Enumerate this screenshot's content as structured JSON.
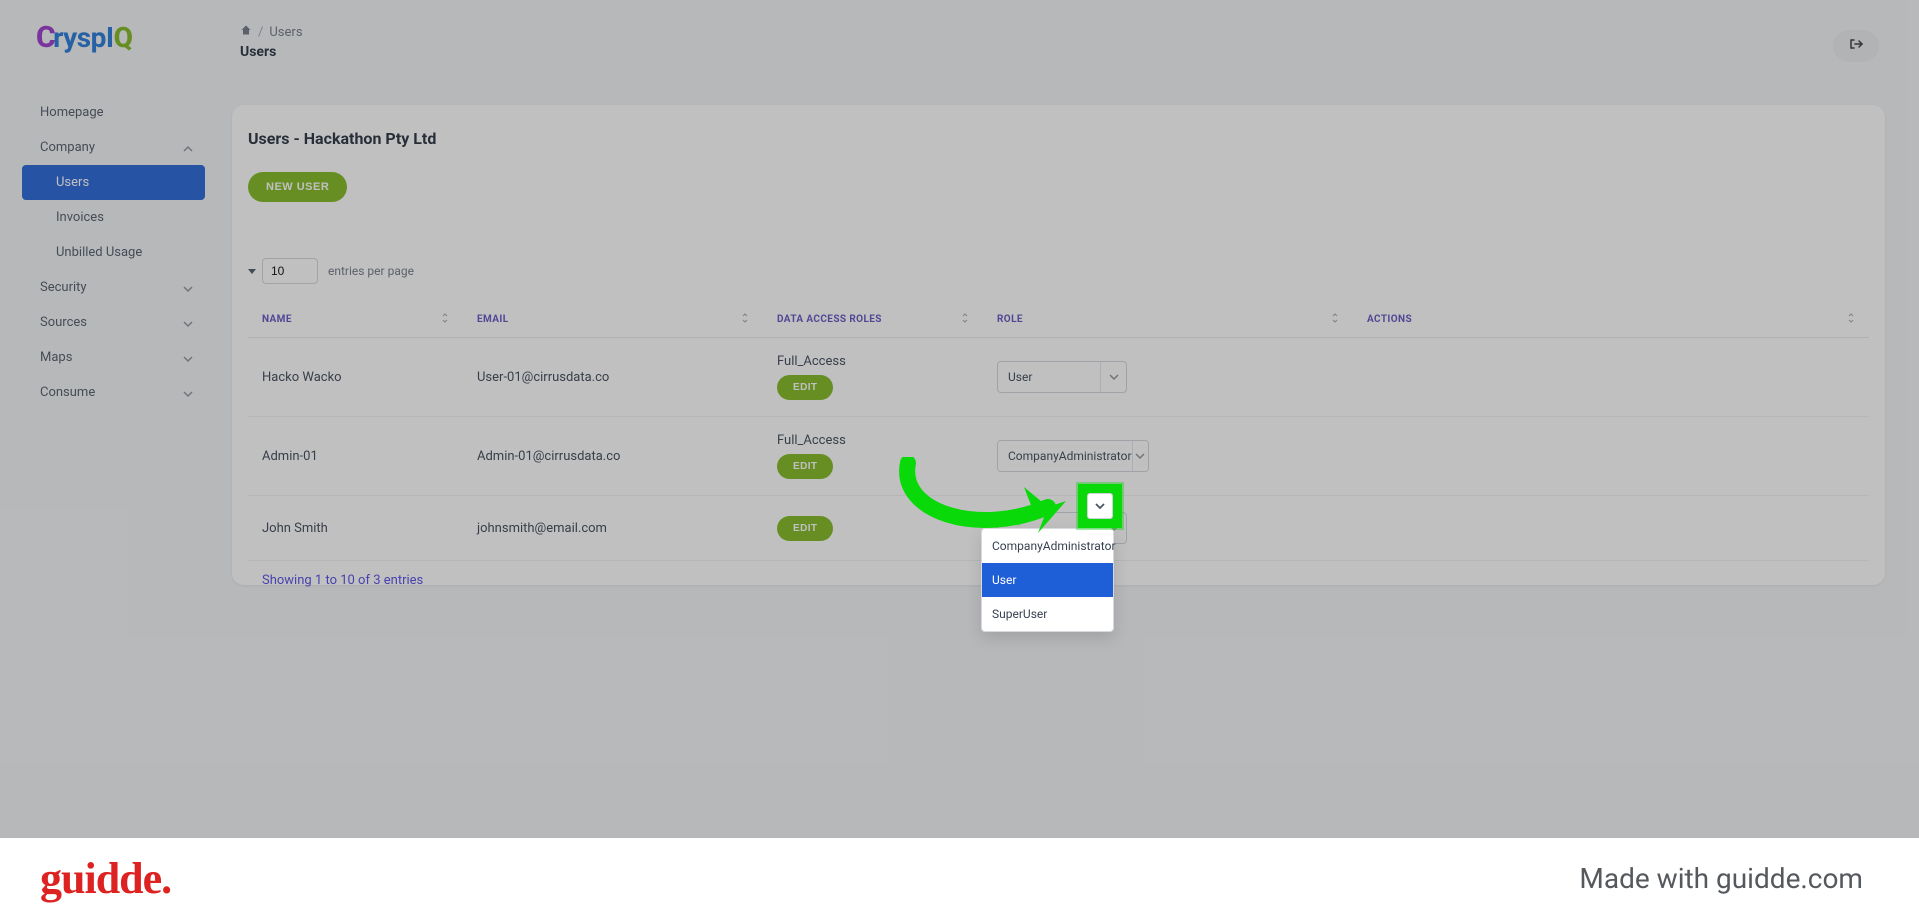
{
  "logo": {
    "brand": "CryspIQ"
  },
  "breadcrumb": {
    "sep": "/",
    "current": "Users"
  },
  "page_title": "Users",
  "sidebar": {
    "items": [
      {
        "label": "Homepage"
      },
      {
        "label": "Company"
      },
      {
        "label": "Users"
      },
      {
        "label": "Invoices"
      },
      {
        "label": "Unbilled Usage"
      },
      {
        "label": "Security"
      },
      {
        "label": "Sources"
      },
      {
        "label": "Maps"
      },
      {
        "label": "Consume"
      }
    ]
  },
  "card": {
    "title": "Users - Hackathon Pty Ltd",
    "new_user_label": "NEW USER"
  },
  "entries": {
    "value": "10",
    "suffix": "entries per page"
  },
  "columns": {
    "name": "NAME",
    "email": "EMAIL",
    "roles": "DATA ACCESS ROLES",
    "role": "ROLE",
    "actions": "ACTIONS"
  },
  "rows": [
    {
      "name": "Hacko Wacko",
      "email": "User-01@cirrusdata.co",
      "roles": "Full_Access",
      "edit": "EDIT",
      "role": "User"
    },
    {
      "name": "Admin-01",
      "email": "Admin-01@cirrusdata.co",
      "roles": "Full_Access",
      "edit": "EDIT",
      "role": "CompanyAdministrator"
    },
    {
      "name": "John Smith",
      "email": "johnsmith@email.com",
      "roles": "",
      "edit": "EDIT",
      "role": ""
    }
  ],
  "dropdown_options": {
    "opt0": "CompanyAdministrator",
    "opt1": "User",
    "opt2": "SuperUser"
  },
  "footer_text": "Showing 1 to 10 of 3 entries",
  "banner": {
    "logo": "guidde.",
    "made": "Made with guidde.com"
  }
}
